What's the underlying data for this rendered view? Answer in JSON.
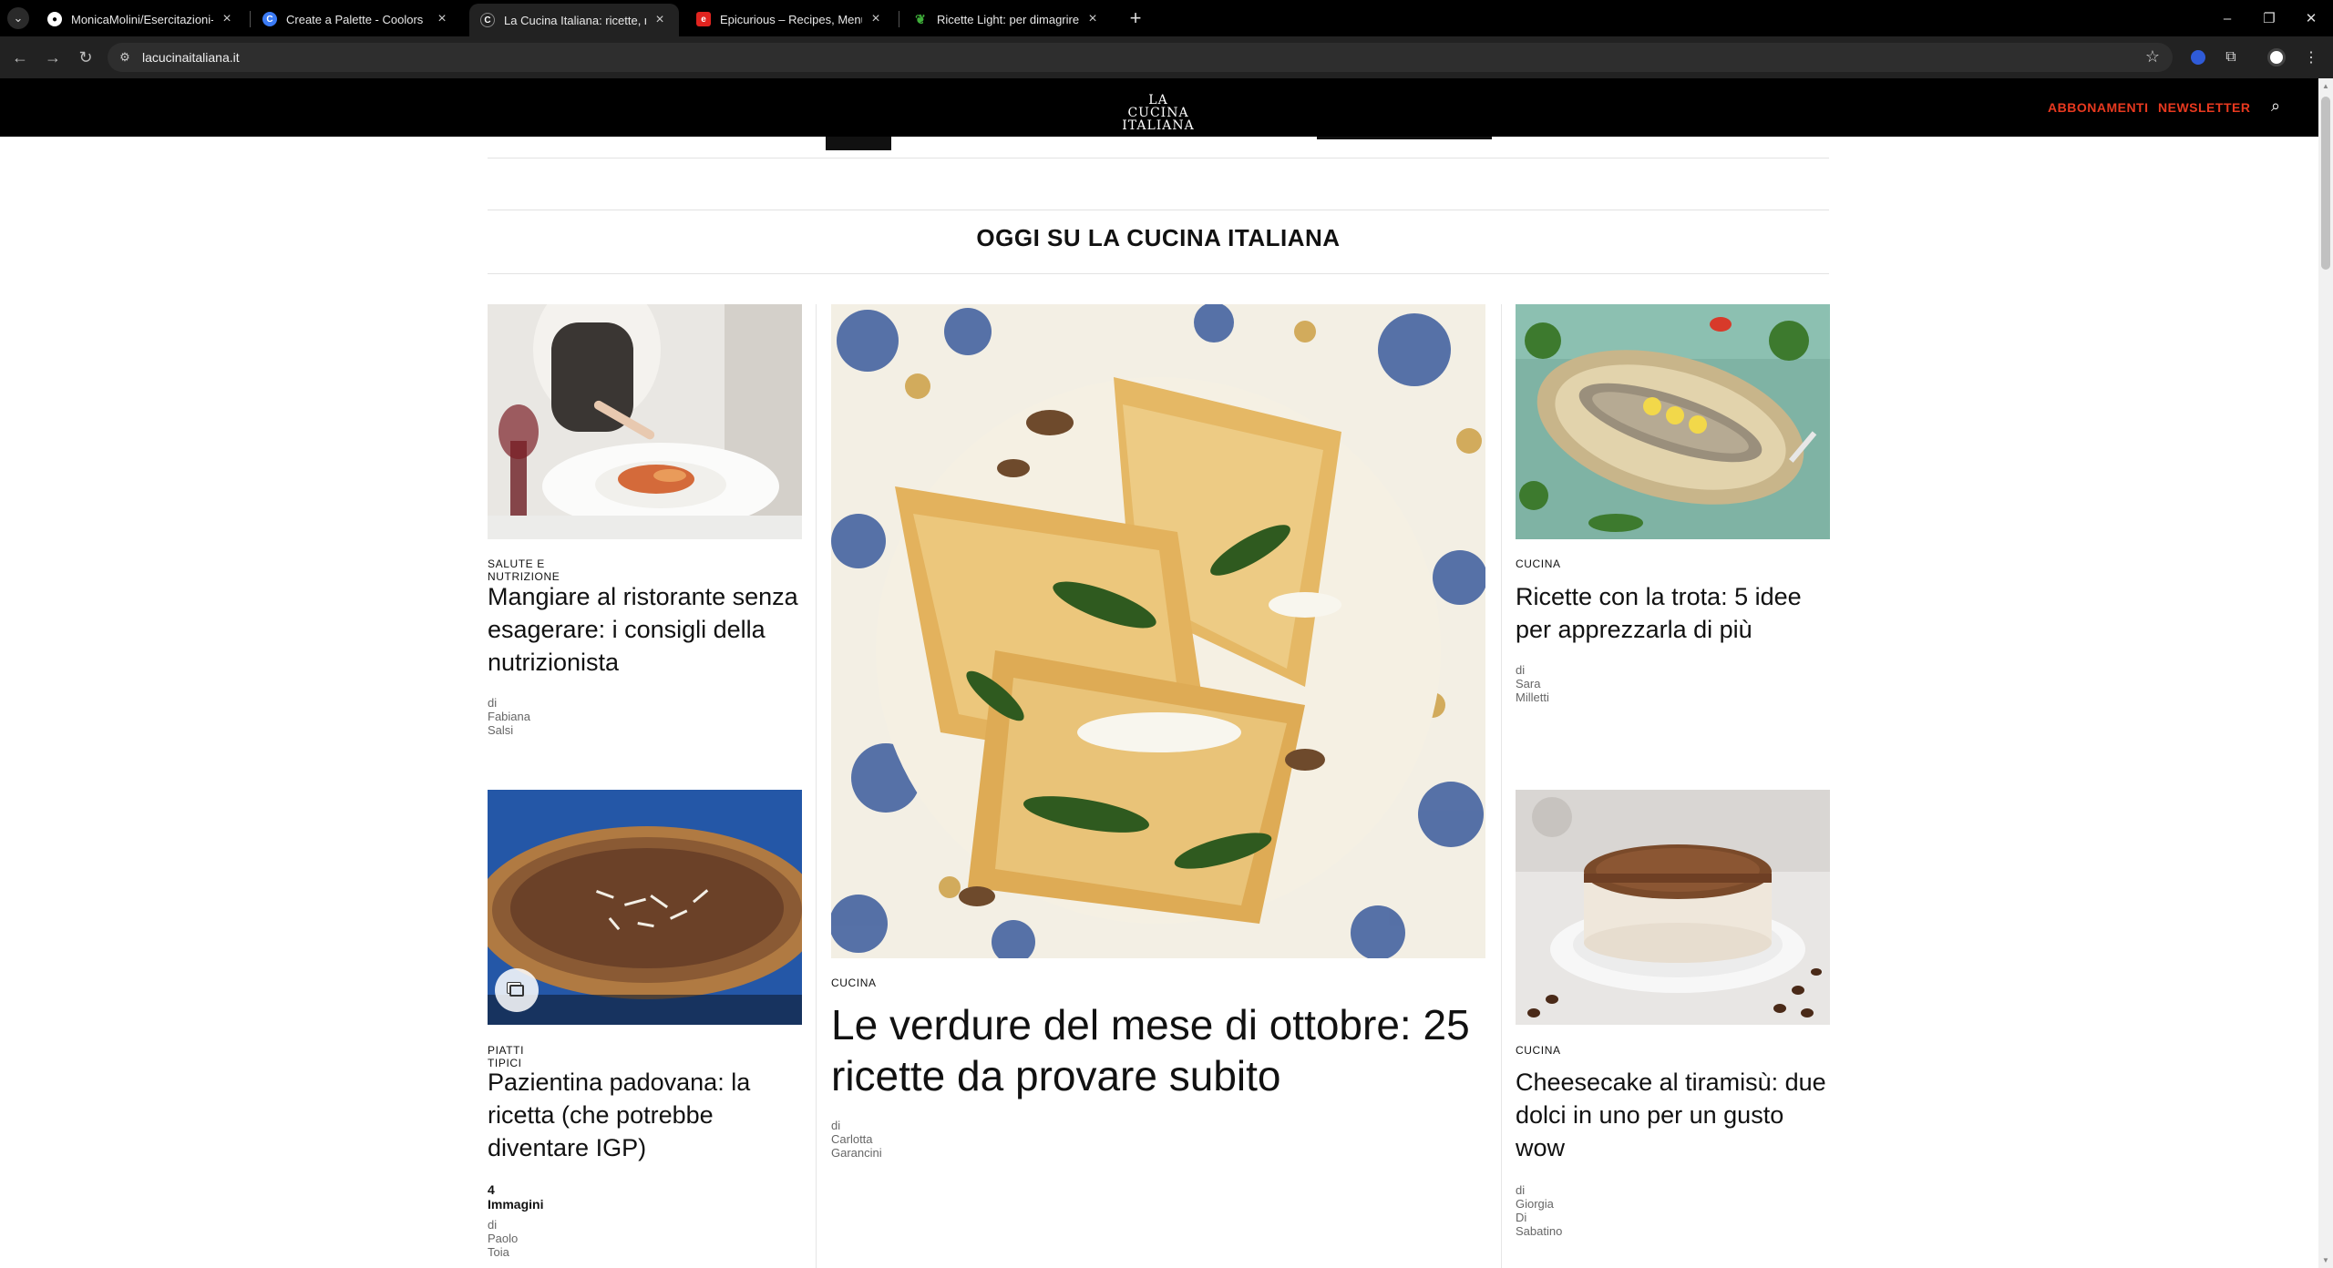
{
  "browser": {
    "tabs": [
      {
        "title": "MonicaMolini/Esercitazioni-live",
        "favicon": "github-icon",
        "active": false
      },
      {
        "title": "Create a Palette - Coolors",
        "favicon": "coolors-icon",
        "active": false
      },
      {
        "title": "La Cucina Italiana: ricette, news",
        "favicon": "lacucinaitaliana-icon",
        "active": true
      },
      {
        "title": "Epicurious – Recipes, Menu Ide",
        "favicon": "epicurious-icon",
        "active": false
      },
      {
        "title": "Ricette Light: per dimagrire ma",
        "favicon": "leaf-icon",
        "active": false
      }
    ],
    "url": "lacucinaitaliana.it"
  },
  "site": {
    "logo_line1": "LA CUCINA",
    "logo_line2": "ITALIANA",
    "nav": {
      "subscriptions": "ABBONAMENTI",
      "newsletter": "NEWSLETTER"
    },
    "accent_color": "#e8391f"
  },
  "section": {
    "title": "OGGI SU LA CUCINA ITALIANA"
  },
  "articles": {
    "top_left": {
      "category": "SALUTE E NUTRIZIONE",
      "title": "Mangiare al ristorante senza esagerare: i consigli della nutrizionista",
      "byline": "di Fabiana Salsi"
    },
    "featured": {
      "category": "CUCINA",
      "title": "Le verdure del mese di ottobre: 25 ricette da provare subito",
      "byline": "di Carlotta Garancini"
    },
    "top_right": {
      "category": "CUCINA",
      "title": "Ricette con la trota: 5 idee per apprezzarla di più",
      "byline": "di Sara Milletti"
    },
    "bottom_left": {
      "category": "PIATTI TIPICI",
      "title": "Pazientina padovana: la ricetta (che potrebbe diventare IGP)",
      "gallery_count": "4 Immagini",
      "byline": "di Paolo Toia"
    },
    "bottom_right": {
      "category": "CUCINA",
      "title": "Cheesecake al tiramisù: due dolci in uno per un gusto wow",
      "byline": "di Giorgia Di Sabatino"
    }
  }
}
